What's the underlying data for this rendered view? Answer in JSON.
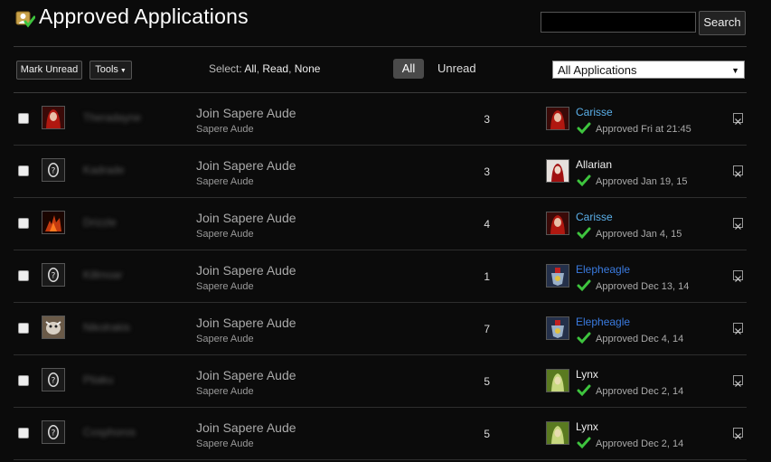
{
  "header": {
    "title": "Approved Applications",
    "search_value": "",
    "search_button": "Search"
  },
  "toolbar": {
    "mark_unread": "Mark Unread",
    "tools": "Tools",
    "select_label": "Select:",
    "select_all": "All",
    "select_read": "Read",
    "select_none": "None",
    "filter_all": "All",
    "filter_unread": "Unread",
    "app_filter": "All Applications"
  },
  "rows": [
    {
      "applicant": "Theradayne",
      "subject": "Join Sapere Aude",
      "group": "Sapere Aude",
      "count": "3",
      "reviewer": "Carisse",
      "reviewer_color": "#5bb0ea",
      "status": "Approved Fri at 21:45",
      "avatar": "red",
      "reviewer_avatar": "red"
    },
    {
      "applicant": "Kadrade",
      "subject": "Join Sapere Aude",
      "group": "Sapere Aude",
      "count": "3",
      "reviewer": "Allarian",
      "reviewer_color": "#eeeeee",
      "status": "Approved Jan 19, 15",
      "avatar": "default",
      "reviewer_avatar": "light"
    },
    {
      "applicant": "Drizzle",
      "subject": "Join Sapere Aude",
      "group": "Sapere Aude",
      "count": "4",
      "reviewer": "Carisse",
      "reviewer_color": "#5bb0ea",
      "status": "Approved Jan 4, 15",
      "avatar": "dragon",
      "reviewer_avatar": "red"
    },
    {
      "applicant": "Killmoar",
      "subject": "Join Sapere Aude",
      "group": "Sapere Aude",
      "count": "1",
      "reviewer": "Elepheagle",
      "reviewer_color": "#3a7be0",
      "status": "Approved Dec 13, 14",
      "avatar": "default",
      "reviewer_avatar": "crest"
    },
    {
      "applicant": "Nikolrakis",
      "subject": "Join Sapere Aude",
      "group": "Sapere Aude",
      "count": "7",
      "reviewer": "Elepheagle",
      "reviewer_color": "#3a7be0",
      "status": "Approved Dec 4, 14",
      "avatar": "beast",
      "reviewer_avatar": "crest"
    },
    {
      "applicant": "Ptiaku",
      "subject": "Join Sapere Aude",
      "group": "Sapere Aude",
      "count": "5",
      "reviewer": "Lynx",
      "reviewer_color": "#eeeeee",
      "status": "Approved Dec 2, 14",
      "avatar": "default",
      "reviewer_avatar": "green"
    },
    {
      "applicant": "Cosphoros",
      "subject": "Join Sapere Aude",
      "group": "Sapere Aude",
      "count": "5",
      "reviewer": "Lynx",
      "reviewer_color": "#eeeeee",
      "status": "Approved Dec 2, 14",
      "avatar": "default",
      "reviewer_avatar": "green"
    }
  ]
}
